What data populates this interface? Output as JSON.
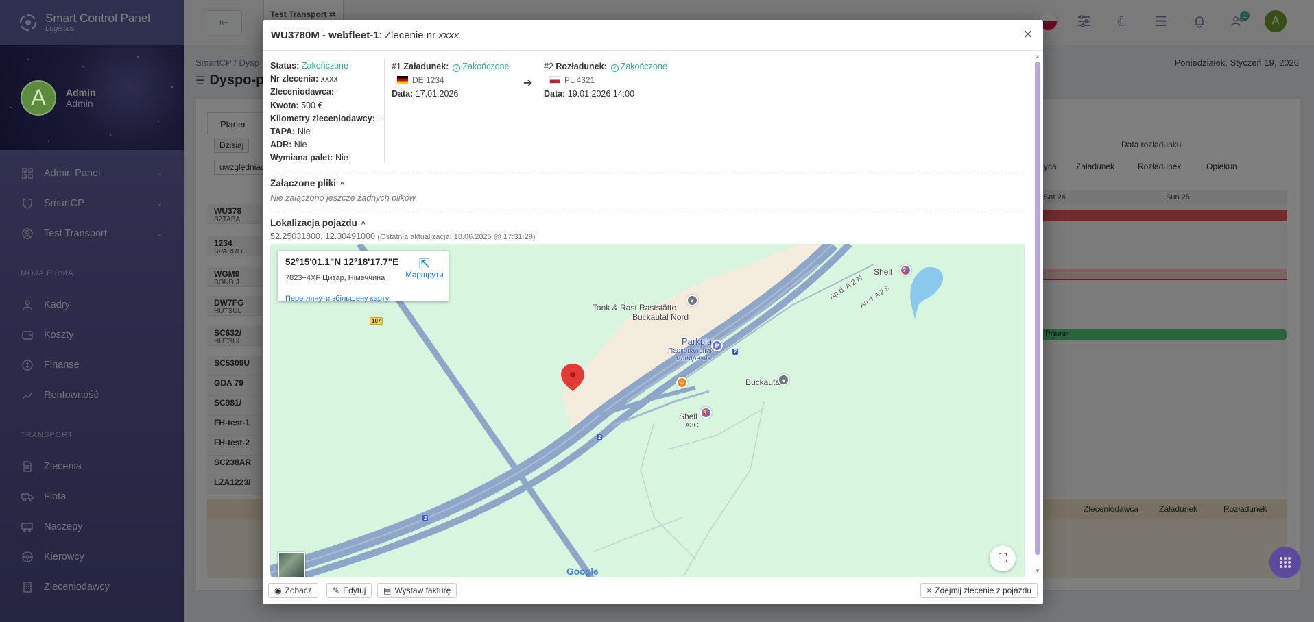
{
  "app": {
    "brand": "Smart Control Panel",
    "brand_sub": "Logistics"
  },
  "user": {
    "avatar_letter": "A",
    "name": "Admin",
    "role": "Admin"
  },
  "sidebar": {
    "main_items": [
      {
        "label": "Admin Panel",
        "icon": "grid-icon"
      },
      {
        "label": "SmartCP",
        "icon": "shield-icon"
      },
      {
        "label": "Test Transport",
        "icon": "building-icon"
      }
    ],
    "section_firm": "MOJA FIRMA",
    "firm_items": [
      {
        "label": "Kadry",
        "icon": "users-icon"
      },
      {
        "label": "Koszty",
        "icon": "wallet-icon"
      },
      {
        "label": "Finanse",
        "icon": "coins-icon"
      },
      {
        "label": "Rentowność",
        "icon": "chart-icon"
      }
    ],
    "section_transport": "TRANSPORT",
    "transport_items": [
      {
        "label": "Zlecenia",
        "icon": "document-icon"
      },
      {
        "label": "Flota",
        "icon": "truck-icon"
      },
      {
        "label": "Naczepy",
        "icon": "trailer-icon"
      },
      {
        "label": "Kierowcy",
        "icon": "steering-icon"
      },
      {
        "label": "Zleceniodawcy",
        "icon": "building-icon"
      }
    ]
  },
  "topbar": {
    "tab_label": "Test Transport",
    "notif_count": "1",
    "avatar_letter": "A"
  },
  "page": {
    "breadcrumb": "SmartCP / Dysp",
    "title": "Dyspo-p",
    "date": "Poniedziałek, Styczeń 19, 2026",
    "tab": "Planer",
    "today_button": "Dzisiaj",
    "filter_value": "uwzględniać",
    "sort_label": "Data rozładunku",
    "col_heads": [
      "yca",
      "Załadunek",
      "Rozładunek",
      "Opiekun"
    ],
    "day_heads": [
      "Sat 24",
      "Sun 25"
    ],
    "bottom_heads": [
      "Zleceniodawca",
      "Załadunek",
      "Rozładunek"
    ],
    "pause_label": "Pause",
    "rows": [
      {
        "title": "WU378",
        "sub": "SZTABA"
      },
      {
        "title": "1234",
        "sub": "SPARRO"
      },
      {
        "title": "WGM9",
        "sub": "BOND J."
      },
      {
        "title": "DW7FG",
        "sub": "HUTSUL"
      },
      {
        "title": "SC632/",
        "sub": "HUTSUL"
      },
      {
        "title": "SC5309U",
        "sub": ""
      },
      {
        "title": "GDA 79",
        "sub": ""
      },
      {
        "title": "SC981/",
        "sub": ""
      },
      {
        "title": "FH-test-1",
        "sub": ""
      },
      {
        "title": "FH-test-2",
        "sub": ""
      },
      {
        "title": "SC238AR",
        "sub": ""
      },
      {
        "title": "LZA1223/",
        "sub": ""
      }
    ]
  },
  "modal": {
    "title_strong": "WU3780M - webfleet-1",
    "title_rest": ": Zlecenie nr ",
    "title_order": "xxxx",
    "info": [
      {
        "label": "Status:",
        "value": "Zakończone",
        "ok": true
      },
      {
        "label": "Nr zlecenia:",
        "value": "xxxx"
      },
      {
        "label": "Zleceniodawca:",
        "value": "-"
      },
      {
        "label": "Kwota:",
        "value": "500 €"
      },
      {
        "label": "Kilometry zleceniodawcy:",
        "value": "-"
      },
      {
        "label": "TAPA:",
        "value": "Nie"
      },
      {
        "label": "ADR:",
        "value": "Nie"
      },
      {
        "label": "Wymiana palet:",
        "value": "Nie"
      }
    ],
    "load": {
      "num": "#1",
      "label": "Załadunek:",
      "status": "Zakończone",
      "plate": "DE 1234",
      "date_label": "Data:",
      "date": "17.01.2026"
    },
    "unload": {
      "num": "#2",
      "label": "Rozładunek:",
      "status": "Zakończone",
      "plate": "PL 4321",
      "date_label": "Data:",
      "date": "19.01.2026 14:00"
    },
    "files": {
      "title": "Załączone pliki",
      "empty": "Nie załączono jeszcze żadnych plików"
    },
    "location": {
      "title": "Lokalizacja pojazdu",
      "coords": "52.25031800, 12.30491000",
      "updated": "(Ostatnia aktualizacja: 18.06.2025 @ 17:31:29)"
    },
    "map": {
      "card_coords": "52°15'01.1\"N 12°18'17.7\"E",
      "card_place": "7823+4XF Цизар, Німеччина",
      "card_link": "Переглянути збільшену карту",
      "directions": "Маршрути",
      "labels": {
        "tank": "Tank & Rast Raststätte",
        "tank2": "Buckautal Nord",
        "parkplatz": "Parkplatz",
        "park_ua1": "Парковальний",
        "park_ua2": "майданчик",
        "shell_top": "Shell",
        "shell": "Shell",
        "shell_sub": "АЗС",
        "buckautal": "Buckautal",
        "road_n": "An d. A 2 N",
        "road_s": "An d. A 2 S",
        "shield_107": "107",
        "shield_2a": "2",
        "shield_2b": "2",
        "shield_2c": "2",
        "google": "Google"
      }
    },
    "footer": {
      "view": "Zobacz",
      "edit": "Edytuj",
      "invoice": "Wystaw fakturę",
      "remove": "Zdejmij zlecenie z pojazdu"
    }
  }
}
